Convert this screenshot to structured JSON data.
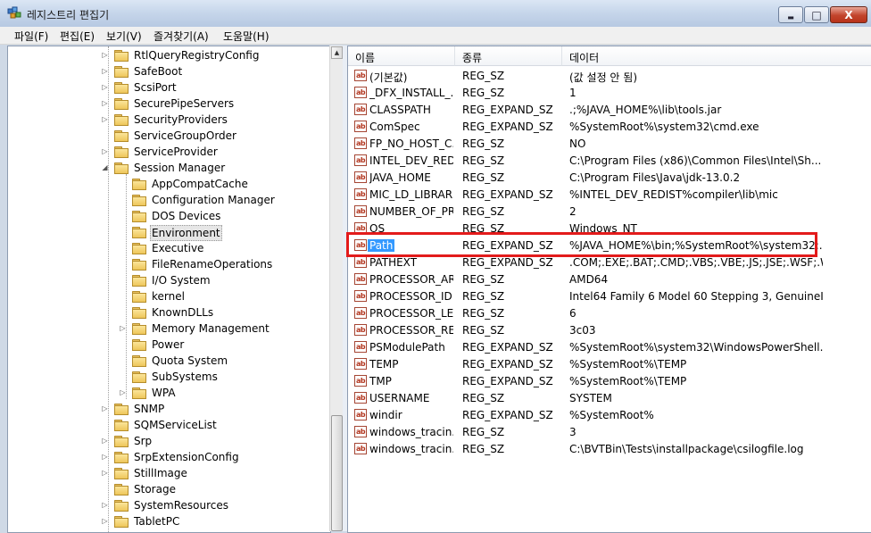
{
  "window": {
    "title": "레지스트리 편집기",
    "minimize_glyph": "▬",
    "maximize_glyph": "□",
    "close_glyph": "X"
  },
  "menu": [
    "파일(F)",
    "편집(E)",
    "보기(V)",
    "즐겨찾기(A)",
    "도움말(H)"
  ],
  "tree": {
    "items": [
      {
        "label": "RtlQueryRegistryConfig",
        "level": 0,
        "expander": "▷"
      },
      {
        "label": "SafeBoot",
        "level": 0,
        "expander": "▷"
      },
      {
        "label": "ScsiPort",
        "level": 0,
        "expander": "▷"
      },
      {
        "label": "SecurePipeServers",
        "level": 0,
        "expander": "▷"
      },
      {
        "label": "SecurityProviders",
        "level": 0,
        "expander": "▷"
      },
      {
        "label": "ServiceGroupOrder",
        "level": 0,
        "expander": ""
      },
      {
        "label": "ServiceProvider",
        "level": 0,
        "expander": "▷"
      },
      {
        "label": "Session Manager",
        "level": 0,
        "expander": "◢"
      },
      {
        "label": "AppCompatCache",
        "level": 1,
        "expander": ""
      },
      {
        "label": "Configuration Manager",
        "level": 1,
        "expander": ""
      },
      {
        "label": "DOS Devices",
        "level": 1,
        "expander": ""
      },
      {
        "label": "Environment",
        "level": 1,
        "expander": "",
        "selected": true
      },
      {
        "label": "Executive",
        "level": 1,
        "expander": ""
      },
      {
        "label": "FileRenameOperations",
        "level": 1,
        "expander": ""
      },
      {
        "label": "I/O System",
        "level": 1,
        "expander": ""
      },
      {
        "label": "kernel",
        "level": 1,
        "expander": ""
      },
      {
        "label": "KnownDLLs",
        "level": 1,
        "expander": ""
      },
      {
        "label": "Memory Management",
        "level": 1,
        "expander": "▷"
      },
      {
        "label": "Power",
        "level": 1,
        "expander": ""
      },
      {
        "label": "Quota System",
        "level": 1,
        "expander": ""
      },
      {
        "label": "SubSystems",
        "level": 1,
        "expander": ""
      },
      {
        "label": "WPA",
        "level": 1,
        "expander": "▷"
      },
      {
        "label": "SNMP",
        "level": 0,
        "expander": "▷"
      },
      {
        "label": "SQMServiceList",
        "level": 0,
        "expander": ""
      },
      {
        "label": "Srp",
        "level": 0,
        "expander": "▷"
      },
      {
        "label": "SrpExtensionConfig",
        "level": 0,
        "expander": "▷"
      },
      {
        "label": "StillImage",
        "level": 0,
        "expander": "▷"
      },
      {
        "label": "Storage",
        "level": 0,
        "expander": ""
      },
      {
        "label": "SystemResources",
        "level": 0,
        "expander": "▷"
      },
      {
        "label": "TabletPC",
        "level": 0,
        "expander": "▷"
      }
    ]
  },
  "list": {
    "columns": [
      "이름",
      "종류",
      "데이터"
    ],
    "icon_text": "ab",
    "rows": [
      {
        "name": "(기본값)",
        "type": "REG_SZ",
        "data": "(값 설정 안 됨)"
      },
      {
        "name": "_DFX_INSTALL_...",
        "type": "REG_SZ",
        "data": "1"
      },
      {
        "name": "CLASSPATH",
        "type": "REG_EXPAND_SZ",
        "data": ".;%JAVA_HOME%\\lib\\tools.jar"
      },
      {
        "name": "ComSpec",
        "type": "REG_EXPAND_SZ",
        "data": "%SystemRoot%\\system32\\cmd.exe"
      },
      {
        "name": "FP_NO_HOST_C...",
        "type": "REG_SZ",
        "data": "NO"
      },
      {
        "name": "INTEL_DEV_RED...",
        "type": "REG_SZ",
        "data": "C:\\Program Files (x86)\\Common Files\\Intel\\Sh..."
      },
      {
        "name": "JAVA_HOME",
        "type": "REG_SZ",
        "data": "C:\\Program Files\\Java\\jdk-13.0.2"
      },
      {
        "name": "MIC_LD_LIBRAR...",
        "type": "REG_EXPAND_SZ",
        "data": "%INTEL_DEV_REDIST%compiler\\lib\\mic"
      },
      {
        "name": "NUMBER_OF_PR...",
        "type": "REG_SZ",
        "data": "2"
      },
      {
        "name": "OS",
        "type": "REG_SZ",
        "data": "Windows_NT"
      },
      {
        "name": "Path",
        "type": "REG_EXPAND_SZ",
        "data": "%JAVA_HOME%\\bin;%SystemRoot%\\system32;...",
        "selected": true
      },
      {
        "name": "PATHEXT",
        "type": "REG_EXPAND_SZ",
        "data": ".COM;.EXE;.BAT;.CMD;.VBS;.VBE;.JS;.JSE;.WSF;.WS..."
      },
      {
        "name": "PROCESSOR_AR...",
        "type": "REG_SZ",
        "data": "AMD64"
      },
      {
        "name": "PROCESSOR_ID...",
        "type": "REG_SZ",
        "data": "Intel64 Family 6 Model 60 Stepping 3, GenuineIn..."
      },
      {
        "name": "PROCESSOR_LE...",
        "type": "REG_SZ",
        "data": "6"
      },
      {
        "name": "PROCESSOR_RE...",
        "type": "REG_SZ",
        "data": "3c03"
      },
      {
        "name": "PSModulePath",
        "type": "REG_EXPAND_SZ",
        "data": "%SystemRoot%\\system32\\WindowsPowerShell..."
      },
      {
        "name": "TEMP",
        "type": "REG_EXPAND_SZ",
        "data": "%SystemRoot%\\TEMP"
      },
      {
        "name": "TMP",
        "type": "REG_EXPAND_SZ",
        "data": "%SystemRoot%\\TEMP"
      },
      {
        "name": "USERNAME",
        "type": "REG_SZ",
        "data": "SYSTEM"
      },
      {
        "name": "windir",
        "type": "REG_EXPAND_SZ",
        "data": "%SystemRoot%"
      },
      {
        "name": "windows_tracin...",
        "type": "REG_SZ",
        "data": "3"
      },
      {
        "name": "windows_tracin...",
        "type": "REG_SZ",
        "data": "C:\\BVTBin\\Tests\\installpackage\\csilogfile.log"
      }
    ]
  },
  "colors": {
    "highlight": "#3399ff",
    "callout_border": "#e31b1b",
    "titlebar": "#c5d5ea"
  }
}
